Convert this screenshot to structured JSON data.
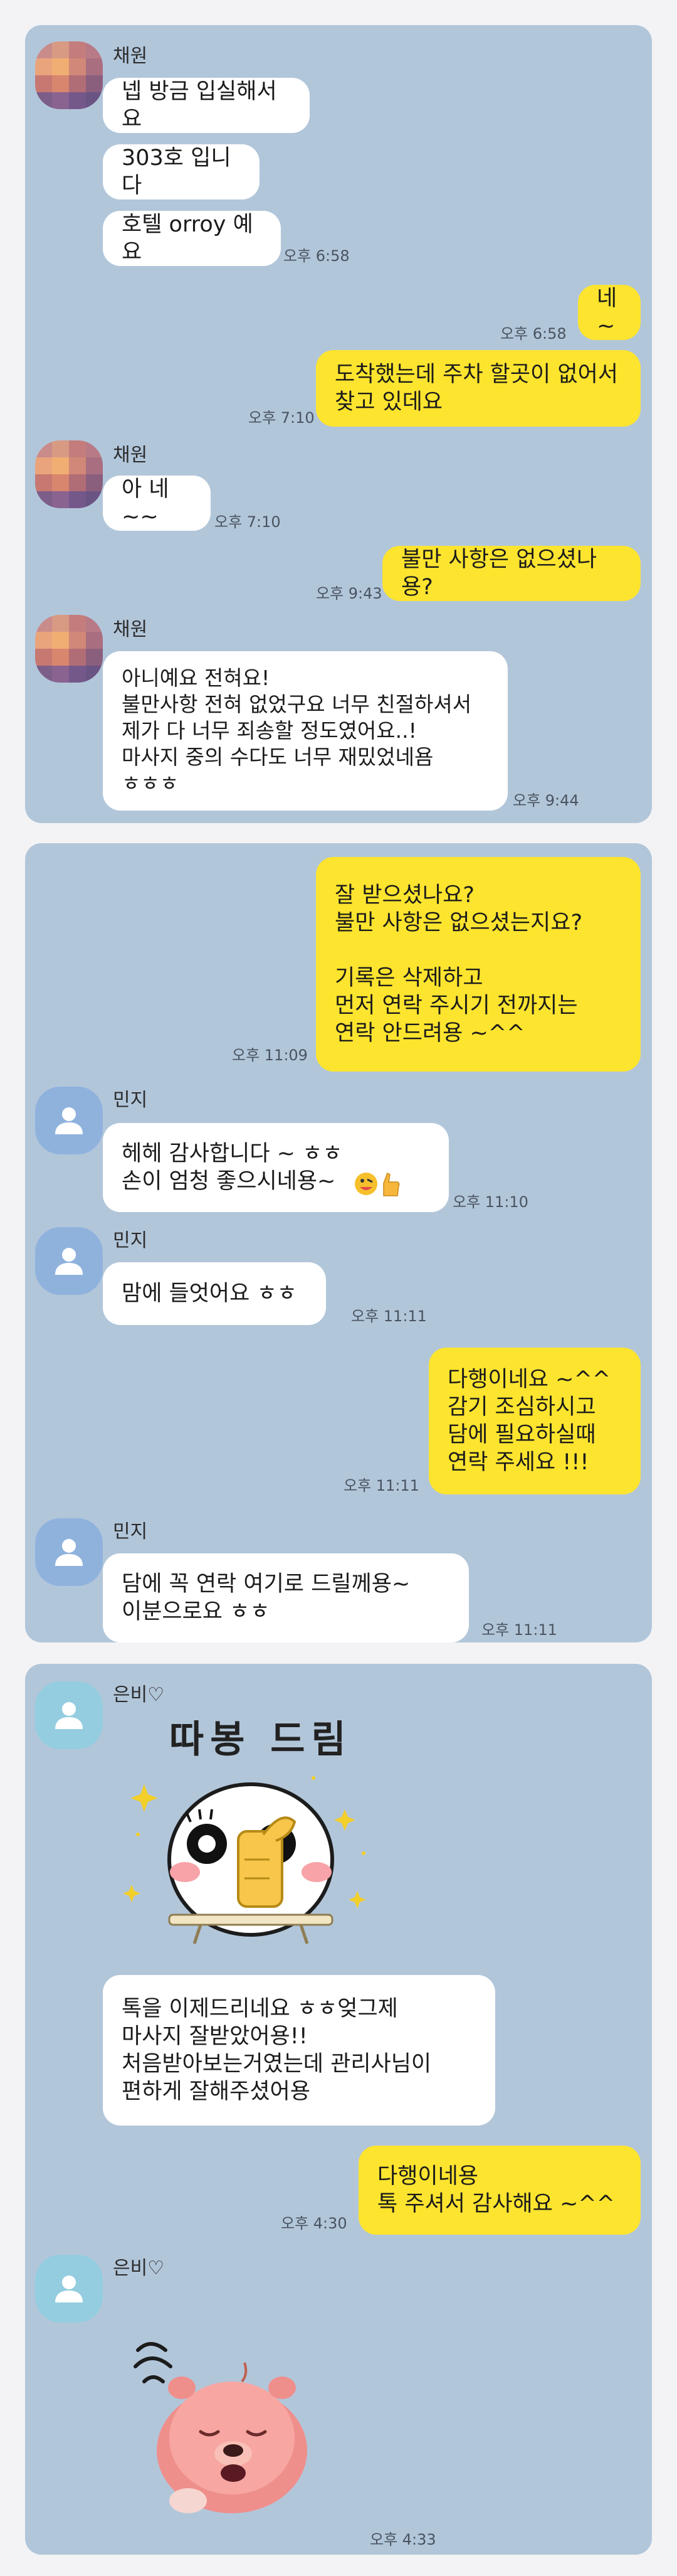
{
  "panel1": {
    "chaewon_name": "채원",
    "msg1": "넵 방금 입실해서요",
    "msg2": "303호 입니다",
    "msg3": "호텔 orroy 예요",
    "time1": "오후 6:58",
    "mine1": "네 ~",
    "time2": "오후 6:58",
    "mine2": "도착했는데  주차 할곳이 없어서\n찾고 있데요",
    "time3": "오후 7:10",
    "msg4": "아 네~~",
    "time4": "오후 7:10",
    "mine3": "불만 사항은 없으셨나용?",
    "time5": "오후 9:43",
    "msg5": "아니예요 전혀요!\n불만사항 전혀 없었구요 너무 친절하셔서\n제가 다 너무 죄송할 정도였어요..!\n마사지 중의 수다도 너무 재밌었네욤\nㅎㅎㅎ",
    "time6": "오후 9:44"
  },
  "panel2": {
    "mine1": "잘 받으셨나요?\n불만 사항은 없으셨는지요?\n\n기록은 삭제하고\n먼저 연락 주시기 전까지는\n연락 안드려용 ~^^",
    "time1": "오후 11:09",
    "minji_name": "민지",
    "msg1": "헤헤 감사합니다 ~ ㅎㅎ\n손이 엄청 좋으시네용~",
    "time2": "오후 11:10",
    "msg2": "맘에 들엇어요 ㅎㅎ",
    "time3": "오후 11:11",
    "mine2": "다행이네요 ~^^\n감기 조심하시고\n담에 필요하실때\n연락 주세요 !!!",
    "time4": "오후 11:11",
    "msg3": "담에 꼭 연락 여기로 드릴께용~\n이분으로요 ㅎㅎ",
    "time5": "오후 11:11"
  },
  "panel3": {
    "eunbi_name": "은비♡",
    "sticker1_text": "따봉 드림",
    "msg1": "톡을 이제드리네요 ㅎㅎ엊그제\n마사지 잘받았어용!!\n처음받아보는거였는데 관리사님이\n편하게 잘해주셨어용",
    "mine1": "다행이네용\n톡 주셔서 감사해요 ~^^",
    "time1": "오후 4:30",
    "time2": "오후 4:33"
  },
  "colors": {
    "chat_background": "#b2c6da",
    "my_bubble": "#fde42f",
    "their_bubble": "#ffffff",
    "page_background": "#f3f3f5"
  }
}
